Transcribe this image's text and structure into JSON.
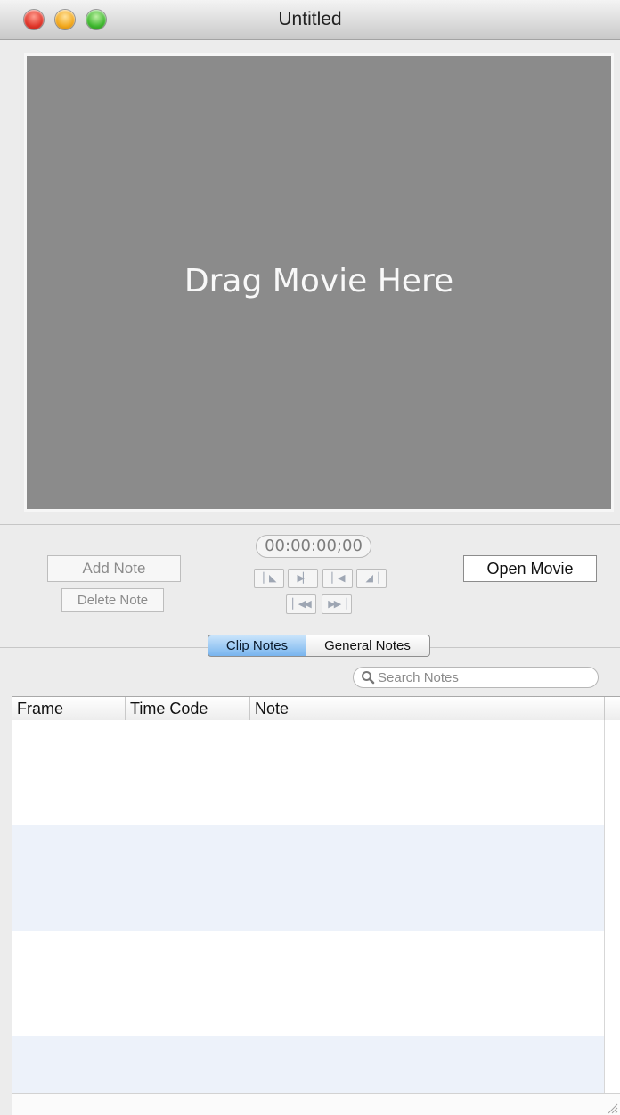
{
  "window": {
    "title": "Untitled"
  },
  "movie": {
    "placeholder": "Drag Movie Here"
  },
  "controls": {
    "add_note": "Add Note",
    "delete_note": "Delete Note",
    "timecode": "00:00:00;00",
    "open_movie": "Open Movie",
    "transport_icons": [
      "mark-in-icon",
      "play-icon",
      "step-back-icon",
      "mark-out-icon",
      "rewind-icon",
      "fast-forward-icon"
    ]
  },
  "tabs": [
    {
      "label": "Clip Notes",
      "selected": true
    },
    {
      "label": "General Notes",
      "selected": false
    }
  ],
  "search": {
    "placeholder": "Search Notes"
  },
  "table": {
    "columns": [
      "Frame",
      "Time Code",
      "Note"
    ],
    "rows": []
  },
  "colors": {
    "selected_tab": "#78b4ee",
    "alt_row": "#edf2fa",
    "movie_background": "#8b8b8b"
  }
}
